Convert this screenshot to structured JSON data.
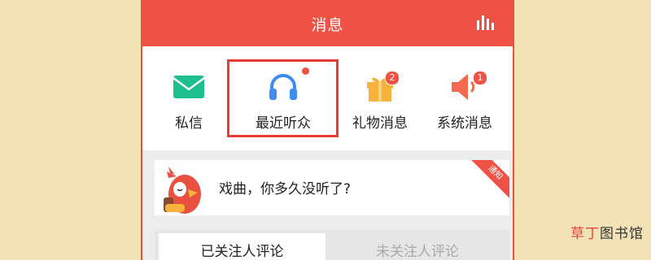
{
  "header": {
    "title": "消息",
    "stats_icon": "bar-chart-icon"
  },
  "categories": [
    {
      "label": "私信",
      "icon": "envelope-icon",
      "color": "#1dbf8f"
    },
    {
      "label": "最近听众",
      "icon": "headphones-icon",
      "color": "#3d8df0",
      "indicator": "dot"
    },
    {
      "label": "礼物消息",
      "icon": "gift-icon",
      "color": "#f6b23a",
      "badge": "2"
    },
    {
      "label": "系统消息",
      "icon": "speaker-icon",
      "color": "#f26a4f",
      "badge": "1"
    }
  ],
  "banner": {
    "text": "戏曲，你多久没听了?",
    "ribbon": "通知"
  },
  "tabs": {
    "active": "已关注人评论",
    "inactive": "未关注人评论"
  },
  "watermark": {
    "part1": "草丁",
    "part2": "图书馆"
  },
  "colors": {
    "accent": "#ef5145",
    "highlight": "#e83b32",
    "background": "#f2e2b4"
  }
}
